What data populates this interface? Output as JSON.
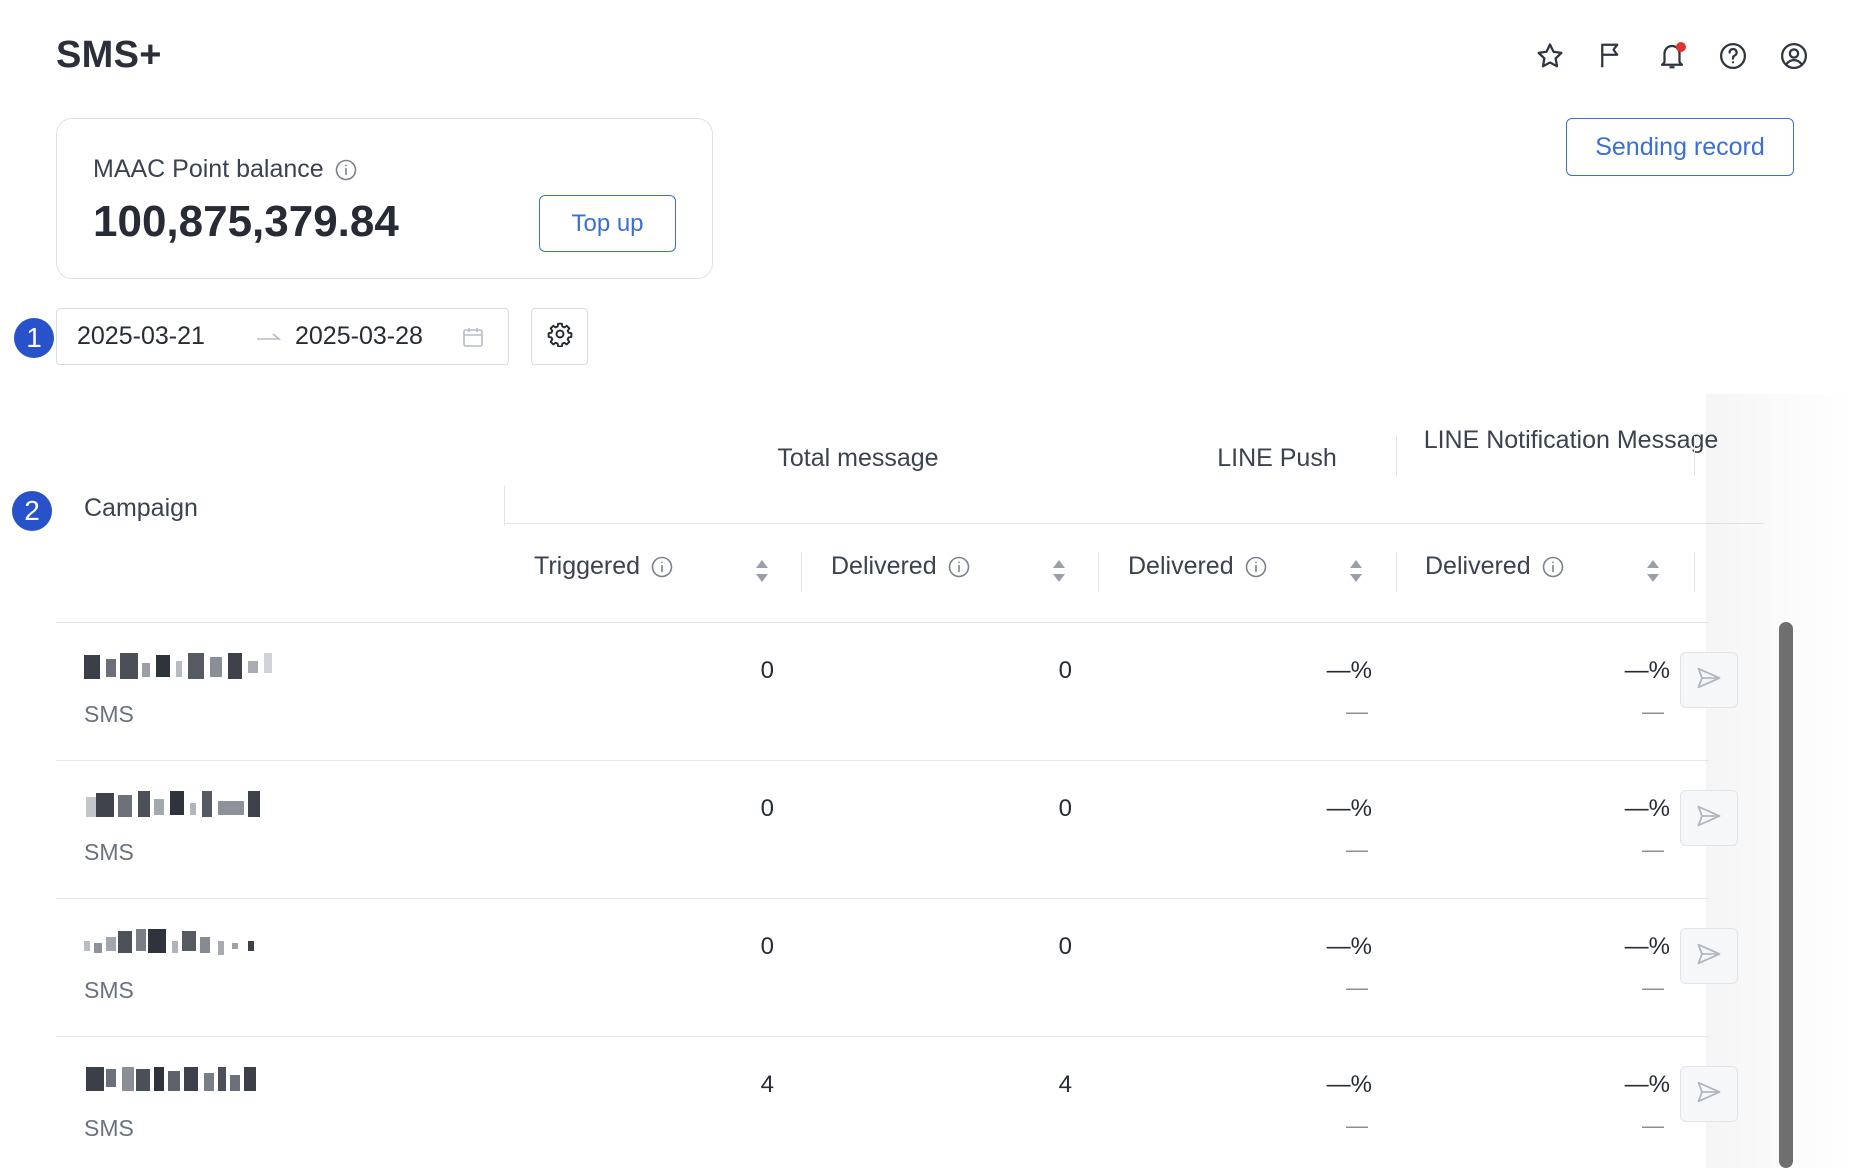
{
  "header": {
    "title": "SMS+",
    "icons": [
      "star-icon",
      "flag-icon",
      "bell-icon",
      "help-icon",
      "user-icon"
    ]
  },
  "balance": {
    "label": "MAAC Point balance",
    "value": "100,875,379.84",
    "topup_label": "Top up"
  },
  "sending_record_label": "Sending record",
  "steps": [
    "1",
    "2"
  ],
  "date_filter": {
    "start": "2025-03-21",
    "end": "2025-03-28"
  },
  "table": {
    "campaign_header": "Campaign",
    "group_headers": [
      "Total message",
      "LINE Push",
      "LINE Notification Message"
    ],
    "sub_headers": [
      "Triggered",
      "Delivered",
      "Delivered",
      "Delivered"
    ],
    "rows": [
      {
        "type": "SMS",
        "triggered": "0",
        "delivered": "0",
        "line_push": "—%",
        "line_push_sub": "—",
        "line_notif": "—%",
        "line_notif_sub": "—"
      },
      {
        "type": "SMS",
        "triggered": "0",
        "delivered": "0",
        "line_push": "—%",
        "line_push_sub": "—",
        "line_notif": "—%",
        "line_notif_sub": "—"
      },
      {
        "type": "SMS",
        "triggered": "0",
        "delivered": "0",
        "line_push": "—%",
        "line_push_sub": "—",
        "line_notif": "—%",
        "line_notif_sub": "—"
      },
      {
        "type": "SMS",
        "triggered": "4",
        "delivered": "4",
        "line_push": "—%",
        "line_push_sub": "—",
        "line_notif": "—%",
        "line_notif_sub": "—"
      }
    ]
  },
  "colors": {
    "accent": "#3a6fd8",
    "step_badge": "#2852c9",
    "notification_dot": "#e0332f"
  }
}
